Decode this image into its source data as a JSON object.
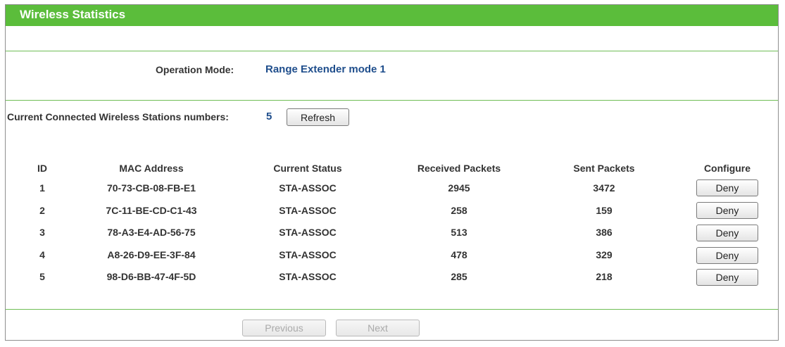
{
  "header": {
    "title": "Wireless Statistics"
  },
  "operation_mode": {
    "label": "Operation Mode:",
    "value": "Range Extender mode 1"
  },
  "stations": {
    "label": "Current Connected Wireless Stations numbers:",
    "count": "5",
    "refresh_label": "Refresh"
  },
  "table": {
    "headers": {
      "id": "ID",
      "mac": "MAC Address",
      "status": "Current Status",
      "received": "Received Packets",
      "sent": "Sent Packets",
      "configure": "Configure"
    },
    "rows": [
      {
        "id": "1",
        "mac": "70-73-CB-08-FB-E1",
        "status": "STA-ASSOC",
        "received": "2945",
        "sent": "3472",
        "action": "Deny"
      },
      {
        "id": "2",
        "mac": "7C-11-BE-CD-C1-43",
        "status": "STA-ASSOC",
        "received": "258",
        "sent": "159",
        "action": "Deny"
      },
      {
        "id": "3",
        "mac": "78-A3-E4-AD-56-75",
        "status": "STA-ASSOC",
        "received": "513",
        "sent": "386",
        "action": "Deny"
      },
      {
        "id": "4",
        "mac": "A8-26-D9-EE-3F-84",
        "status": "STA-ASSOC",
        "received": "478",
        "sent": "329",
        "action": "Deny"
      },
      {
        "id": "5",
        "mac": "98-D6-BB-47-4F-5D",
        "status": "STA-ASSOC",
        "received": "285",
        "sent": "218",
        "action": "Deny"
      }
    ]
  },
  "pagination": {
    "previous_label": "Previous",
    "next_label": "Next"
  },
  "colors": {
    "accent": "#5bbd3b",
    "value_text": "#1f4e8c"
  }
}
